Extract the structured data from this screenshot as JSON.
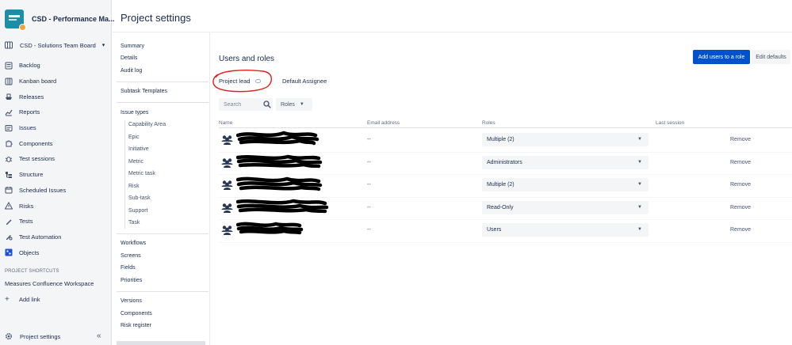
{
  "project": {
    "name": "CSD - Performance Ma...",
    "board": "CSD - Solutions Team Board"
  },
  "sidebar": {
    "items": [
      {
        "label": "Backlog",
        "icon": "backlog-icon"
      },
      {
        "label": "Kanban board",
        "icon": "kanban-icon"
      },
      {
        "label": "Releases",
        "icon": "ship-icon"
      },
      {
        "label": "Reports",
        "icon": "chart-icon"
      },
      {
        "label": "Issues",
        "icon": "issues-icon"
      },
      {
        "label": "Components",
        "icon": "puzzle-icon"
      },
      {
        "label": "Test sessions",
        "icon": "bug-icon"
      },
      {
        "label": "Structure",
        "icon": "structure-icon"
      },
      {
        "label": "Scheduled Issues",
        "icon": "calendar-icon"
      },
      {
        "label": "Risks",
        "icon": "warning-icon"
      },
      {
        "label": "Tests",
        "icon": "pen-icon"
      },
      {
        "label": "Test Automation",
        "icon": "pen-gear-icon"
      },
      {
        "label": "Objects",
        "icon": "objects-icon"
      }
    ],
    "shortcuts_heading": "PROJECT SHORTCUTS",
    "shortcut": "Measures Confluence Workspace",
    "add_link": "Add link",
    "project_settings": "Project settings",
    "collapse": "«"
  },
  "page": {
    "title": "Project settings"
  },
  "settings_nav": {
    "group1": [
      "Summary",
      "Details",
      "Audit log"
    ],
    "subtask_templates": "Subtask Templates",
    "issue_types_heading": "Issue types",
    "issue_types": [
      "Capability Area",
      "Epic",
      "Initiative",
      "Metric",
      "Metric task",
      "Risk",
      "Sub-task",
      "Support",
      "Task"
    ],
    "group3": [
      "Workflows",
      "Screens",
      "Fields",
      "Priorities"
    ],
    "group4": [
      "Versions",
      "Components",
      "Risk register"
    ]
  },
  "main": {
    "section_title": "Users and roles",
    "add_users_button": "Add users to a role",
    "edit_defaults_button": "Edit defaults",
    "project_lead": "Project lead",
    "default_assignee": "Default Assignee",
    "search_placeholder": "Search",
    "roles_filter": "Roles",
    "columns": [
      "Name",
      "Email address",
      "Roles",
      "Last session"
    ],
    "rows": [
      {
        "email": "--",
        "role": "Multiple (2)",
        "action": "Remove"
      },
      {
        "email": "--",
        "role": "Administrators",
        "action": "Remove"
      },
      {
        "email": "--",
        "role": "Multiple (2)",
        "action": "Remove"
      },
      {
        "email": "--",
        "role": "Read-Only",
        "action": "Remove"
      },
      {
        "email": "--",
        "role": "Users",
        "action": "Remove"
      }
    ]
  },
  "colors": {
    "primary_button": "#0052cc",
    "annotation_circle": "#e0201b",
    "sidebar_bg": "#f4f5f7"
  }
}
